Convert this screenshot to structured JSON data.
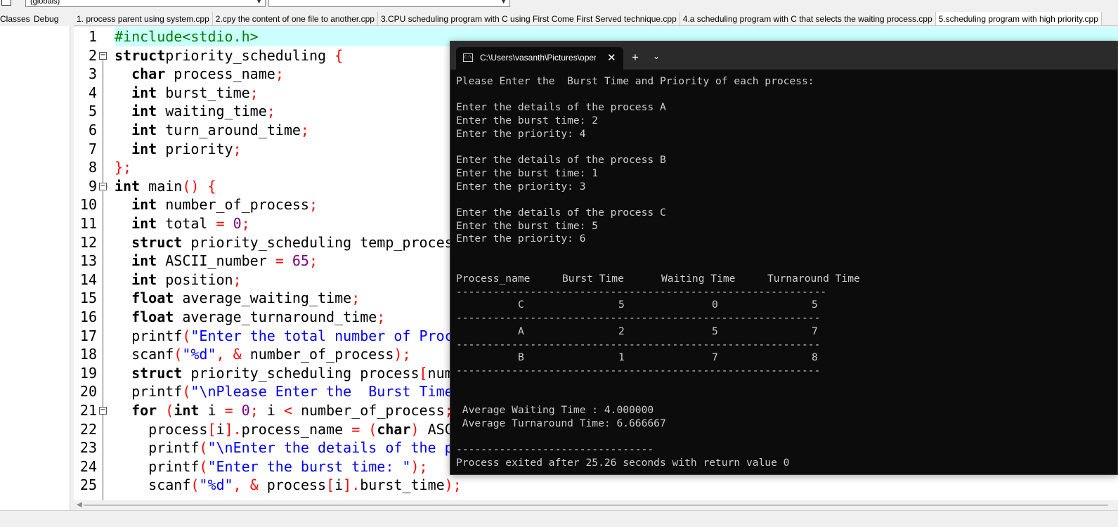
{
  "toolbar": {
    "scope_combo": "(globals)",
    "member_combo": ""
  },
  "left_tabs": [
    "Classes",
    "Debug"
  ],
  "file_tabs": [
    "1. process parent using system.cpp",
    "2.cpy the content of one file to another.cpp",
    "3.CPU scheduling program with C using First Come First Served technique.cpp",
    "4.a scheduling program with C that selects the waiting process.cpp",
    "5.scheduling program with high priority.cpp"
  ],
  "active_tab_index": 4,
  "editor": {
    "line_numbers": [
      "1",
      "2",
      "3",
      "4",
      "5",
      "6",
      "7",
      "8",
      "9",
      "10",
      "11",
      "12",
      "13",
      "14",
      "15",
      "16",
      "17",
      "18",
      "19",
      "20",
      "21",
      "22",
      "23",
      "24",
      "25"
    ],
    "lines": [
      [
        [
          "pp",
          "#include<stdio.h>"
        ]
      ],
      [
        [
          "kw",
          "struct"
        ],
        [
          "",
          "priority_scheduling "
        ],
        [
          "sym",
          "{"
        ]
      ],
      [
        [
          "",
          "  "
        ],
        [
          "kw",
          "char"
        ],
        [
          "",
          " process_name"
        ],
        [
          "sym",
          ";"
        ]
      ],
      [
        [
          "",
          "  "
        ],
        [
          "kw",
          "int"
        ],
        [
          "",
          " burst_time"
        ],
        [
          "sym",
          ";"
        ]
      ],
      [
        [
          "",
          "  "
        ],
        [
          "kw",
          "int"
        ],
        [
          "",
          " waiting_time"
        ],
        [
          "sym",
          ";"
        ]
      ],
      [
        [
          "",
          "  "
        ],
        [
          "kw",
          "int"
        ],
        [
          "",
          " turn_around_time"
        ],
        [
          "sym",
          ";"
        ]
      ],
      [
        [
          "",
          "  "
        ],
        [
          "kw",
          "int"
        ],
        [
          "",
          " priority"
        ],
        [
          "sym",
          ";"
        ]
      ],
      [
        [
          "sym",
          "};"
        ]
      ],
      [
        [
          "kw",
          "int"
        ],
        [
          "",
          " main"
        ],
        [
          "sym",
          "()"
        ],
        [
          "",
          " "
        ],
        [
          "sym",
          "{"
        ]
      ],
      [
        [
          "",
          "  "
        ],
        [
          "kw",
          "int"
        ],
        [
          "",
          " number_of_process"
        ],
        [
          "sym",
          ";"
        ]
      ],
      [
        [
          "",
          "  "
        ],
        [
          "kw",
          "int"
        ],
        [
          "",
          " total "
        ],
        [
          "sym",
          "="
        ],
        [
          "",
          " "
        ],
        [
          "num",
          "0"
        ],
        [
          "sym",
          ";"
        ]
      ],
      [
        [
          "",
          "  "
        ],
        [
          "kw",
          "struct"
        ],
        [
          "",
          " priority_scheduling temp_process"
        ],
        [
          "sym",
          ";"
        ]
      ],
      [
        [
          "",
          "  "
        ],
        [
          "kw",
          "int"
        ],
        [
          "",
          " ASCII_number "
        ],
        [
          "sym",
          "="
        ],
        [
          "",
          " "
        ],
        [
          "num",
          "65"
        ],
        [
          "sym",
          ";"
        ]
      ],
      [
        [
          "",
          "  "
        ],
        [
          "kw",
          "int"
        ],
        [
          "",
          " position"
        ],
        [
          "sym",
          ";"
        ]
      ],
      [
        [
          "",
          "  "
        ],
        [
          "kw",
          "float"
        ],
        [
          "",
          " average_waiting_time"
        ],
        [
          "sym",
          ";"
        ]
      ],
      [
        [
          "",
          "  "
        ],
        [
          "kw",
          "float"
        ],
        [
          "",
          " average_turnaround_time"
        ],
        [
          "sym",
          ";"
        ]
      ],
      [
        [
          "",
          "  printf"
        ],
        [
          "sym",
          "("
        ],
        [
          "str",
          "\"Enter the total number of Processes: \""
        ],
        [
          "sym",
          ");"
        ]
      ],
      [
        [
          "",
          "  scanf"
        ],
        [
          "sym",
          "("
        ],
        [
          "str",
          "\"%d\""
        ],
        [
          "sym",
          ","
        ],
        [
          "",
          " "
        ],
        [
          "sym",
          "&"
        ],
        [
          "",
          " number_of_process"
        ],
        [
          "sym",
          ");"
        ]
      ],
      [
        [
          "",
          "  "
        ],
        [
          "kw",
          "struct"
        ],
        [
          "",
          " priority_scheduling process"
        ],
        [
          "sym",
          "["
        ],
        [
          "",
          "number_of_process"
        ],
        [
          "sym",
          "];"
        ]
      ],
      [
        [
          "",
          "  printf"
        ],
        [
          "sym",
          "("
        ],
        [
          "str",
          "\"\\nPlease Enter the  Burst Time and Priority\""
        ],
        [
          "sym",
          ");"
        ]
      ],
      [
        [
          "",
          "  "
        ],
        [
          "kw",
          "for"
        ],
        [
          "",
          " "
        ],
        [
          "sym",
          "("
        ],
        [
          "kw",
          "int"
        ],
        [
          "",
          " i "
        ],
        [
          "sym",
          "="
        ],
        [
          "",
          " "
        ],
        [
          "num",
          "0"
        ],
        [
          "sym",
          ";"
        ],
        [
          "",
          " i "
        ],
        [
          "sym",
          "<"
        ],
        [
          "",
          " number_of_process"
        ],
        [
          "sym",
          ";"
        ]
      ],
      [
        [
          "",
          "    process"
        ],
        [
          "sym",
          "["
        ],
        [
          "",
          "i"
        ],
        [
          "sym",
          "]."
        ],
        [
          "",
          "process_name "
        ],
        [
          "sym",
          "="
        ],
        [
          "",
          " "
        ],
        [
          "sym",
          "("
        ],
        [
          "kw",
          "char"
        ],
        [
          "sym",
          ")"
        ],
        [
          "",
          " ASCII_number"
        ],
        [
          "sym",
          ";"
        ]
      ],
      [
        [
          "",
          "    printf"
        ],
        [
          "sym",
          "("
        ],
        [
          "str",
          "\"\\nEnter the details of the process\""
        ],
        [
          "sym",
          ");"
        ]
      ],
      [
        [
          "",
          "    printf"
        ],
        [
          "sym",
          "("
        ],
        [
          "str",
          "\"Enter the burst time: \""
        ],
        [
          "sym",
          ");"
        ]
      ],
      [
        [
          "",
          "    scanf"
        ],
        [
          "sym",
          "("
        ],
        [
          "str",
          "\"%d\""
        ],
        [
          "sym",
          ","
        ],
        [
          "",
          " "
        ],
        [
          "sym",
          "&"
        ],
        [
          "",
          " process"
        ],
        [
          "sym",
          "["
        ],
        [
          "",
          "i"
        ],
        [
          "sym",
          "]."
        ],
        [
          "",
          "burst_time"
        ],
        [
          "sym",
          ");"
        ]
      ]
    ]
  },
  "console": {
    "tab_title": "C:\\Users\\vasanth\\Pictures\\operating system",
    "tab_icon_text": "C:\\",
    "new_tab_symbol": "+",
    "menu_symbol": "⌄",
    "close_symbol": "✕",
    "lines": [
      "Please Enter the  Burst Time and Priority of each process:",
      "",
      "Enter the details of the process A",
      "Enter the burst time: 2",
      "Enter the priority: 4",
      "",
      "Enter the details of the process B",
      "Enter the burst time: 1",
      "Enter the priority: 3",
      "",
      "Enter the details of the process C",
      "Enter the burst time: 5",
      "Enter the priority: 6"
    ],
    "table_headers": [
      "Process_name",
      "Burst Time",
      "Waiting Time",
      "Turnaround Time"
    ],
    "table_rows": [
      [
        "C",
        "5",
        "0",
        "5"
      ],
      [
        "A",
        "2",
        "5",
        "7"
      ],
      [
        "B",
        "1",
        "7",
        "8"
      ]
    ],
    "separator_long": "------------------------------------------------------------",
    "separator_row": "-----------------------------------------------------------",
    "avg_waiting": " Average Waiting Time : 4.000000",
    "avg_turnaround": " Average Turnaround Time: 6.666667",
    "separator_short": "--------------------------------",
    "exit_message": "Process exited after 25.26 seconds with return value 0"
  }
}
